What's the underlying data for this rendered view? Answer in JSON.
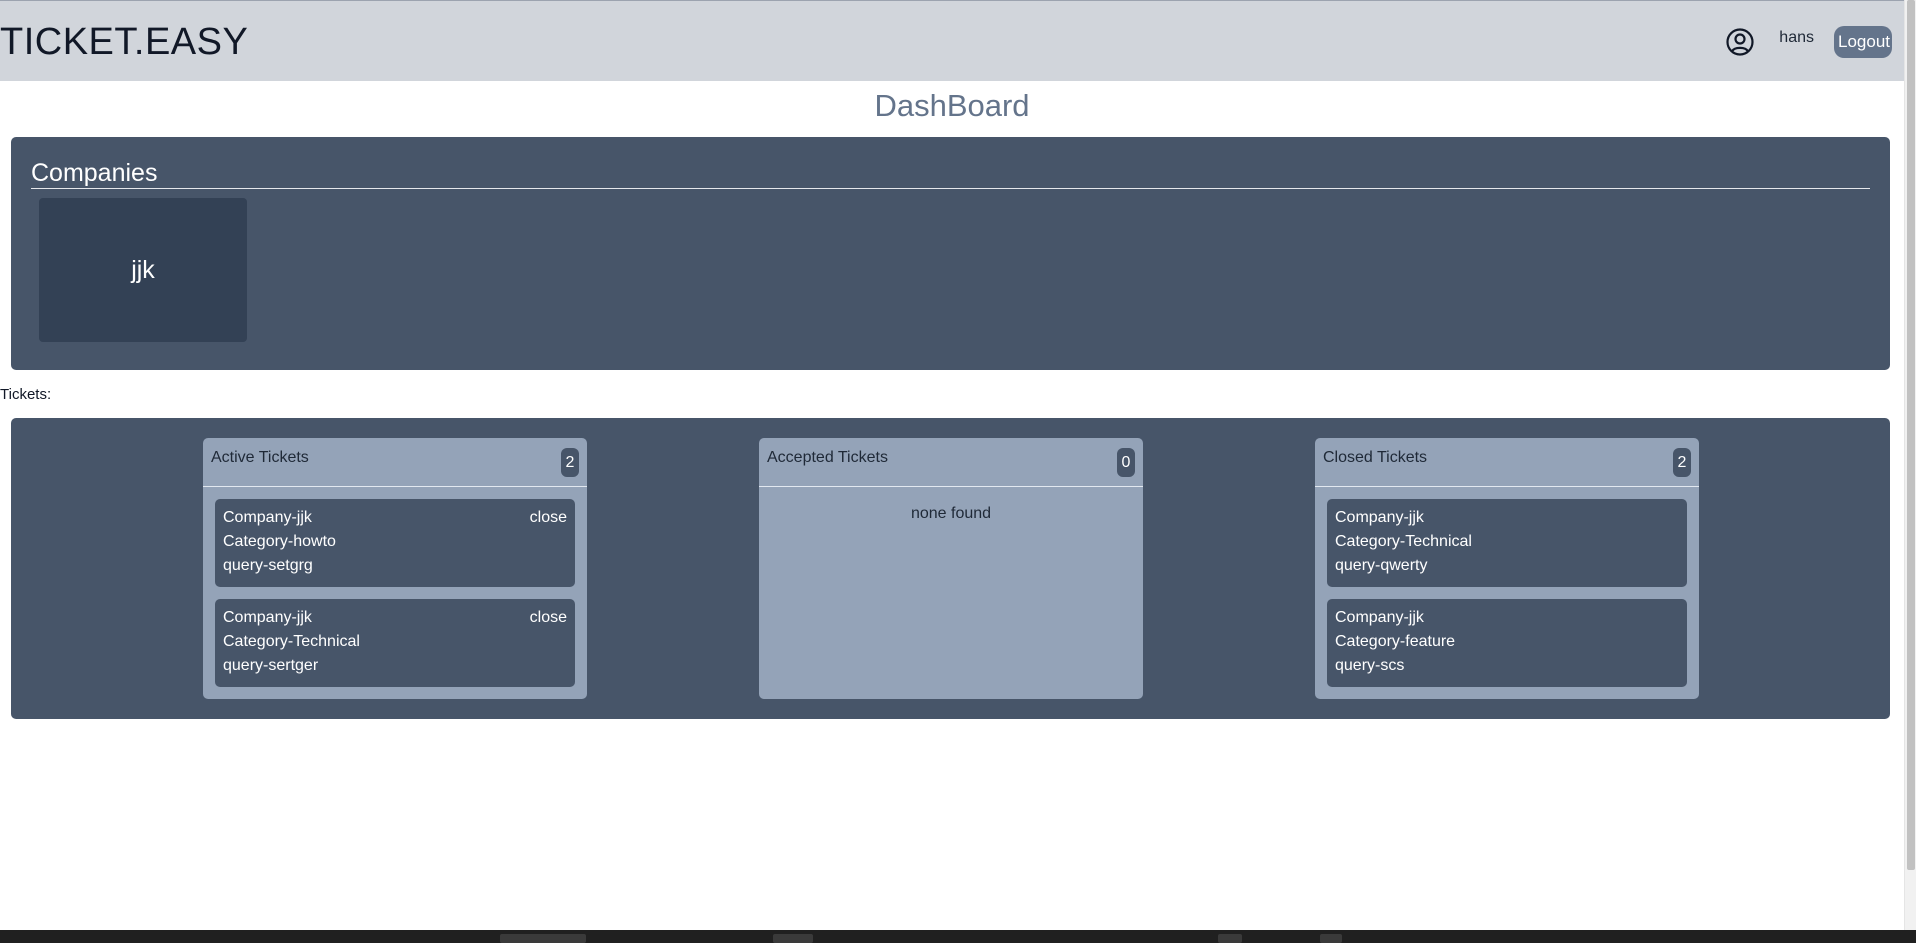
{
  "header": {
    "brand": "TICKET.EASY",
    "username": "hans",
    "logout_label": "Logout",
    "user_icon": "user-circle-icon"
  },
  "page_title": "DashBoard",
  "companies": {
    "title": "Companies",
    "items": [
      {
        "name": "jjk"
      }
    ]
  },
  "tickets_label": "Tickets:",
  "columns": {
    "active": {
      "title": "Active Tickets",
      "count": "2",
      "tickets": [
        {
          "company": "Company-jjk",
          "category": "Category-howto",
          "query": "query-setgrg",
          "action": "close"
        },
        {
          "company": "Company-jjk",
          "category": "Category-Technical",
          "query": "query-sertger",
          "action": "close"
        }
      ]
    },
    "accepted": {
      "title": "Accepted Tickets",
      "count": "0",
      "empty_text": "none found"
    },
    "closed": {
      "title": "Closed Tickets",
      "count": "2",
      "tickets": [
        {
          "company": "Company-jjk",
          "category": "Category-Technical",
          "query": "query-qwerty"
        },
        {
          "company": "Company-jjk",
          "category": "Category-feature",
          "query": "query-scs"
        }
      ]
    }
  },
  "colors": {
    "topbar": "#d1d5db",
    "panel": "#475569",
    "card_dark": "#334155",
    "column": "#94a3b8",
    "title_text": "#64748b"
  }
}
